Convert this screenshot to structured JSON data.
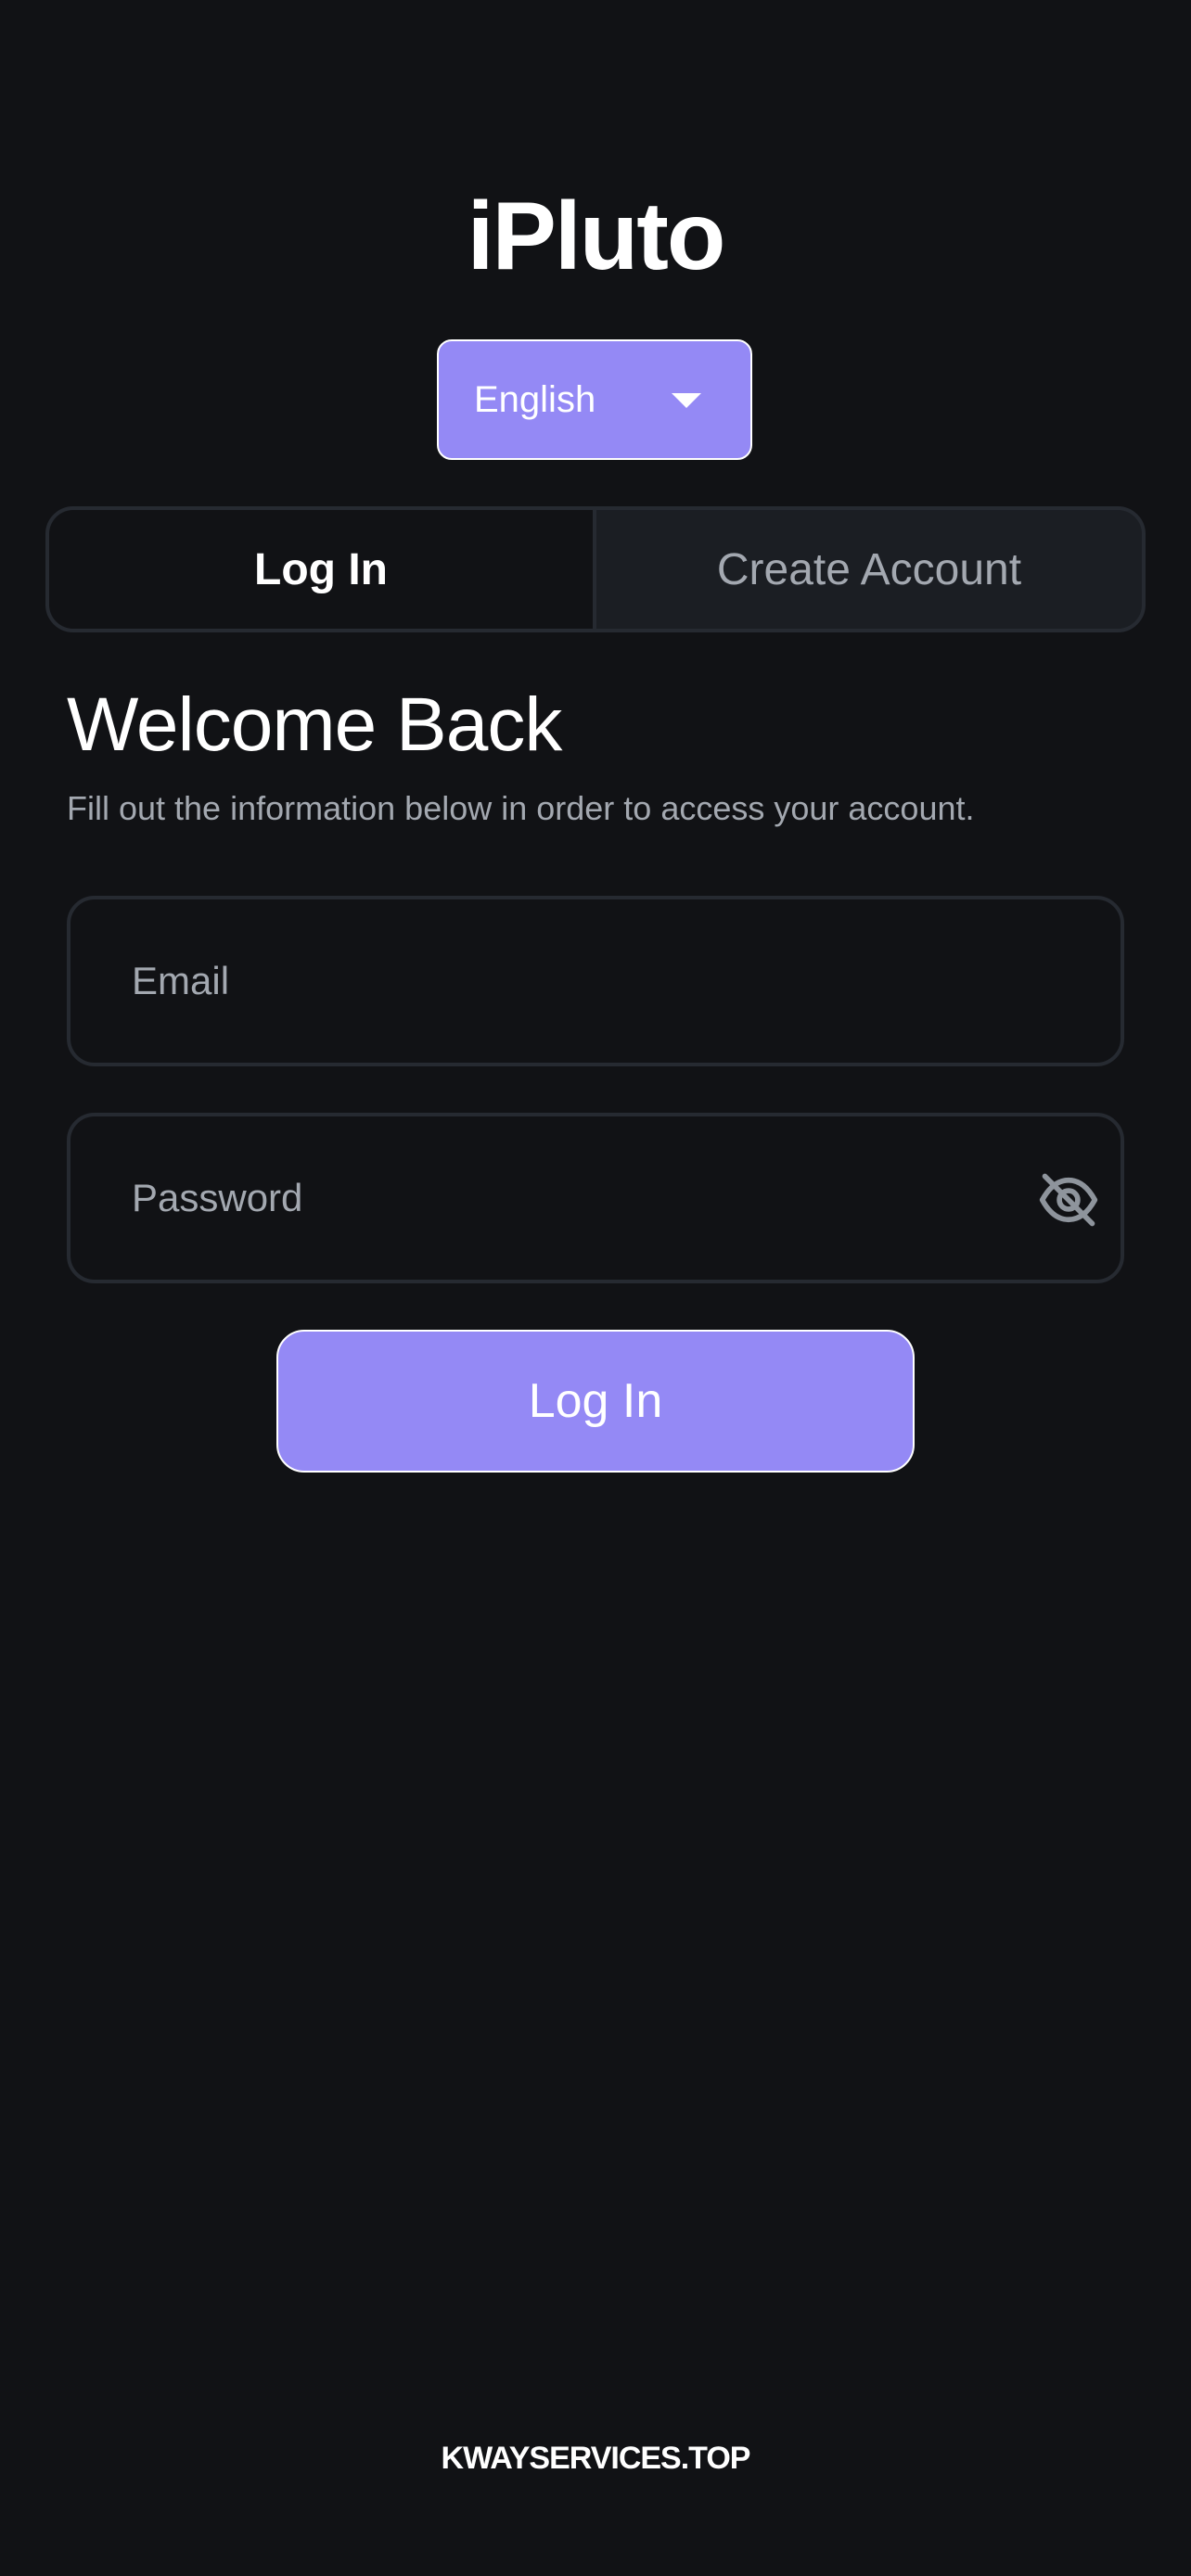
{
  "app": {
    "title": "iPluto"
  },
  "language_select": {
    "value": "English"
  },
  "tabs": {
    "login": "Log In",
    "create_account": "Create Account"
  },
  "welcome": {
    "heading": "Welcome Back",
    "subtitle": "Fill out the information below in order to access your account."
  },
  "form": {
    "email_placeholder": "Email",
    "email_value": "",
    "password_placeholder": "Password",
    "password_value": "",
    "password_toggle_icon": "eye-off-icon",
    "submit_label": "Log In"
  },
  "footer": {
    "link": "KWAYSERVICES.TOP"
  },
  "colors": {
    "background": "#111215",
    "accent": "#9489f5",
    "border": "#262a31",
    "muted_text": "#a3a8b0"
  }
}
